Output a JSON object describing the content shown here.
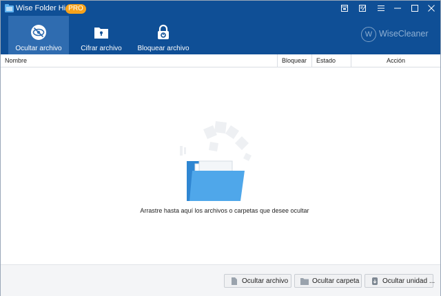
{
  "app": {
    "title": "Wise Folder Hider",
    "badge": "PRO",
    "brand": "WiseCleaner",
    "brand_mark": "W"
  },
  "titlebar_icons": [
    "feedback-icon",
    "notes-icon",
    "menu-icon",
    "minimize-icon",
    "maximize-icon",
    "close-icon"
  ],
  "toolbar": {
    "tabs": [
      {
        "label": "Ocultar archivo",
        "icon": "eye-slash-icon",
        "active": true
      },
      {
        "label": "Cifrar archivo",
        "icon": "folder-lock-icon",
        "active": false
      },
      {
        "label": "Bloquear archivo",
        "icon": "padlock-icon",
        "active": false
      }
    ]
  },
  "table": {
    "columns": [
      "Nombre",
      "Bloquear",
      "Estado",
      "Acción"
    ],
    "rows": []
  },
  "empty_state": {
    "message": "Arrastre hasta aquí los archivos o carpetas que desee ocultar"
  },
  "footer": {
    "buttons": [
      {
        "label": "Ocultar archivo",
        "icon": "file-icon"
      },
      {
        "label": "Ocultar carpeta",
        "icon": "folder-icon"
      },
      {
        "label": "Ocultar unidad ...",
        "icon": "usb-drive-icon"
      }
    ]
  },
  "colors": {
    "header_blue": "#0f4f96",
    "active_tab": "#2f6cb0",
    "pro_badge": "#f6a21b",
    "folder_blue": "#3f9be0"
  }
}
